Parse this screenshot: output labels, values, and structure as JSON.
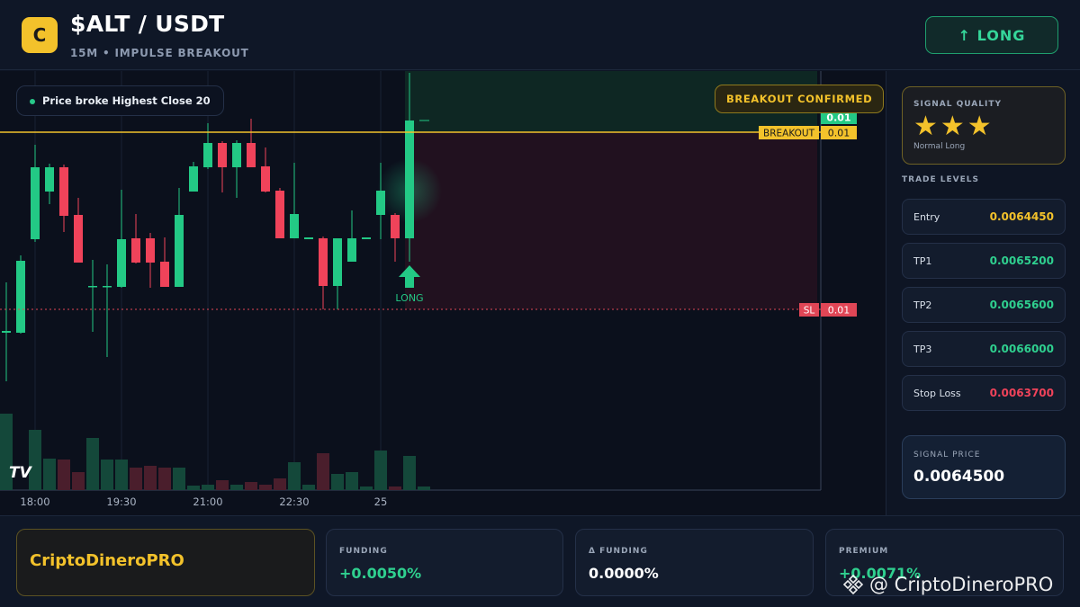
{
  "header": {
    "logo_letter": "C",
    "pair": "$ALT / USDT",
    "subtitle": "15M • IMPULSE BREAKOUT",
    "long_button": "↑ LONG"
  },
  "chart": {
    "signal_pill": "Price broke Highest Close 20",
    "breakout_badge": "BREAKOUT CONFIRMED",
    "breakout_tag": "BREAKOUT",
    "breakout_value": "0.01",
    "top_value": "0.01",
    "sl_tag": "SL",
    "sl_value": "0.01",
    "long_marker": "LONG",
    "time_labels": [
      "18:00",
      "19:30",
      "21:00",
      "22:30",
      "25"
    ],
    "tv_logo": "TV",
    "colors": {
      "up": "#23c985",
      "down": "#f0435a",
      "breakout": "#f3c22b",
      "sl": "#e04656"
    }
  },
  "sidebar": {
    "signal_quality_title": "SIGNAL QUALITY",
    "stars": "★★★",
    "signal_quality_sub": "Normal Long",
    "trade_levels_title": "TRADE LEVELS",
    "levels": [
      {
        "label": "Entry",
        "value": "0.0064450",
        "color": "#f3c22b"
      },
      {
        "label": "TP1",
        "value": "0.0065200",
        "color": "#2fd08f"
      },
      {
        "label": "TP2",
        "value": "0.0065600",
        "color": "#2fd08f"
      },
      {
        "label": "TP3",
        "value": "0.0066000",
        "color": "#2fd08f"
      },
      {
        "label": "Stop Loss",
        "value": "0.0063700",
        "color": "#f0435a"
      }
    ],
    "signal_price_title": "SIGNAL PRICE",
    "signal_price": "0.0064500"
  },
  "footer": {
    "brand": "CriptoDineroPRO",
    "stats": [
      {
        "title": "FUNDING",
        "value": "+0.0050%",
        "color": "#2fd08f"
      },
      {
        "title": "Δ FUNDING",
        "value": "0.0000%",
        "color": "#ffffff"
      },
      {
        "title": "PREMIUM",
        "value": "+0.0071%",
        "color": "#2fd08f"
      }
    ],
    "watermark": "@ CriptoDineroPRO"
  }
}
